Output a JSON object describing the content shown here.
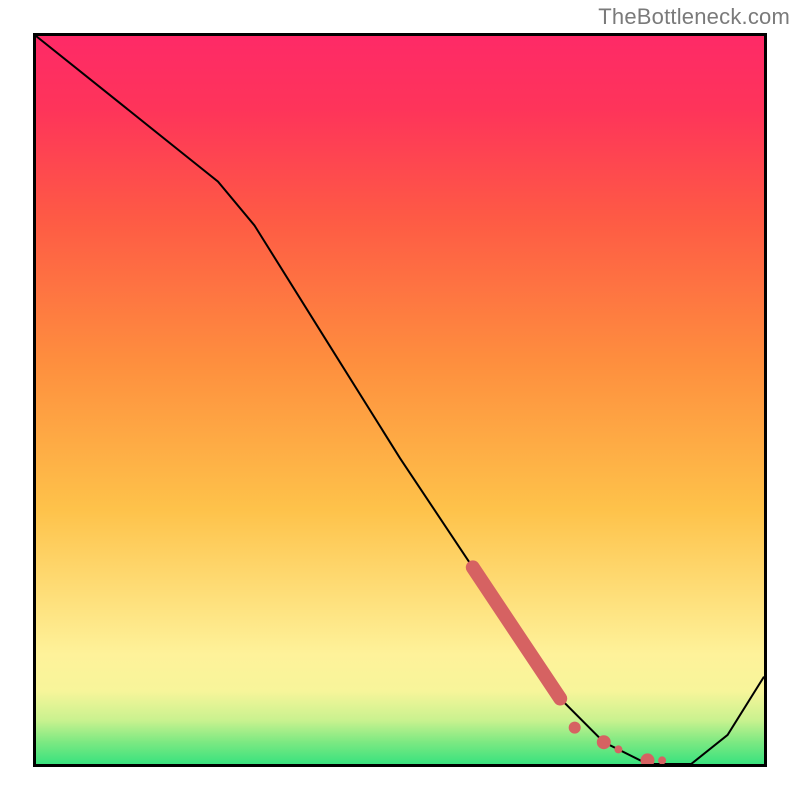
{
  "watermark": "TheBottleneck.com",
  "chart_data": {
    "type": "line",
    "title": "",
    "xlabel": "",
    "ylabel": "",
    "xlim": [
      0,
      100
    ],
    "ylim": [
      0,
      100
    ],
    "grid": false,
    "legend": false,
    "background_gradient": {
      "stops": [
        {
          "pos": 0.0,
          "color": "#39e27e"
        },
        {
          "pos": 0.03,
          "color": "#7ce982"
        },
        {
          "pos": 0.06,
          "color": "#c9f28f"
        },
        {
          "pos": 0.1,
          "color": "#f7f59a"
        },
        {
          "pos": 0.15,
          "color": "#fef29a"
        },
        {
          "pos": 0.35,
          "color": "#fec24a"
        },
        {
          "pos": 0.55,
          "color": "#fe8f3e"
        },
        {
          "pos": 0.75,
          "color": "#fe5a45"
        },
        {
          "pos": 0.9,
          "color": "#fe345a"
        },
        {
          "pos": 1.0,
          "color": "#fe2a67"
        }
      ]
    },
    "series": [
      {
        "name": "curve",
        "color": "#000000",
        "stroke_width": 2,
        "x": [
          0,
          10,
          20,
          25,
          30,
          40,
          50,
          60,
          68,
          72,
          78,
          84,
          90,
          95,
          100
        ],
        "y": [
          100,
          92,
          84,
          80,
          74,
          58,
          42,
          27,
          15,
          9,
          3,
          0,
          0,
          4,
          12
        ]
      }
    ],
    "markers": {
      "name": "highlight-segment",
      "color": "#d66262",
      "thick_segment": {
        "x": [
          60,
          68,
          72
        ],
        "y": [
          27,
          15,
          9
        ],
        "width": 14
      },
      "dots": [
        {
          "x": 74,
          "y": 5,
          "r": 6
        },
        {
          "x": 78,
          "y": 3,
          "r": 7
        },
        {
          "x": 80,
          "y": 2,
          "r": 4
        },
        {
          "x": 84,
          "y": 0.5,
          "r": 7
        },
        {
          "x": 86,
          "y": 0.5,
          "r": 4
        }
      ]
    }
  }
}
